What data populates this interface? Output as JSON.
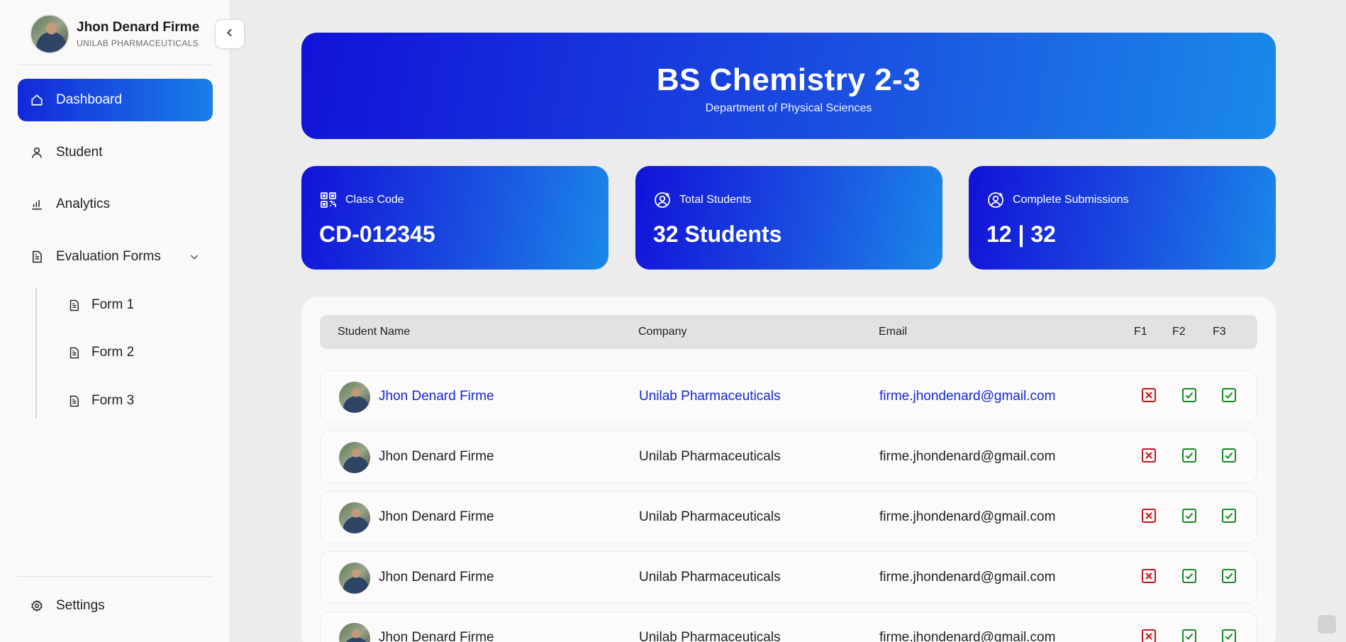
{
  "profile": {
    "name": "Jhon Denard Firme",
    "company": "UNILAB PHARMACEUTICALS"
  },
  "nav": {
    "dashboard": "Dashboard",
    "student": "Student",
    "analytics": "Analytics",
    "evaluation_forms": "Evaluation Forms",
    "forms": [
      "Form 1",
      "Form 2",
      "Form 3"
    ],
    "settings": "Settings"
  },
  "banner": {
    "title": "BS Chemistry 2-3",
    "subtitle": "Department of Physical Sciences"
  },
  "cards": [
    {
      "label": "Class Code",
      "value": "CD-012345",
      "icon": "qr-code-icon"
    },
    {
      "label": "Total Students",
      "value": "32 Students",
      "icon": "user-plus-icon"
    },
    {
      "label": "Complete Submissions",
      "value": "12 | 32",
      "icon": "user-plus-icon"
    }
  ],
  "table": {
    "headers": {
      "name": "Student Name",
      "company": "Company",
      "email": "Email",
      "f1": "F1",
      "f2": "F2",
      "f3": "F3"
    },
    "rows": [
      {
        "name": "Jhon Denard Firme",
        "company": "Unilab Pharmaceuticals",
        "email": "firme.jhondenard@gmail.com",
        "f1": "incomplete",
        "f2": "complete",
        "f3": "complete"
      },
      {
        "name": "Jhon Denard Firme",
        "company": "Unilab Pharmaceuticals",
        "email": "firme.jhondenard@gmail.com",
        "f1": "incomplete",
        "f2": "complete",
        "f3": "complete"
      },
      {
        "name": "Jhon Denard Firme",
        "company": "Unilab Pharmaceuticals",
        "email": "firme.jhondenard@gmail.com",
        "f1": "incomplete",
        "f2": "complete",
        "f3": "complete"
      },
      {
        "name": "Jhon Denard Firme",
        "company": "Unilab Pharmaceuticals",
        "email": "firme.jhondenard@gmail.com",
        "f1": "incomplete",
        "f2": "complete",
        "f3": "complete"
      },
      {
        "name": "Jhon Denard Firme",
        "company": "Unilab Pharmaceuticals",
        "email": "firme.jhondenard@gmail.com",
        "f1": "incomplete",
        "f2": "complete",
        "f3": "complete"
      }
    ]
  },
  "colors": {
    "accent_start": "#1212d8",
    "accent_end": "#1a88e9",
    "incomplete": "#c0171c",
    "complete": "#138a24",
    "highlight_text": "#1428d6"
  }
}
